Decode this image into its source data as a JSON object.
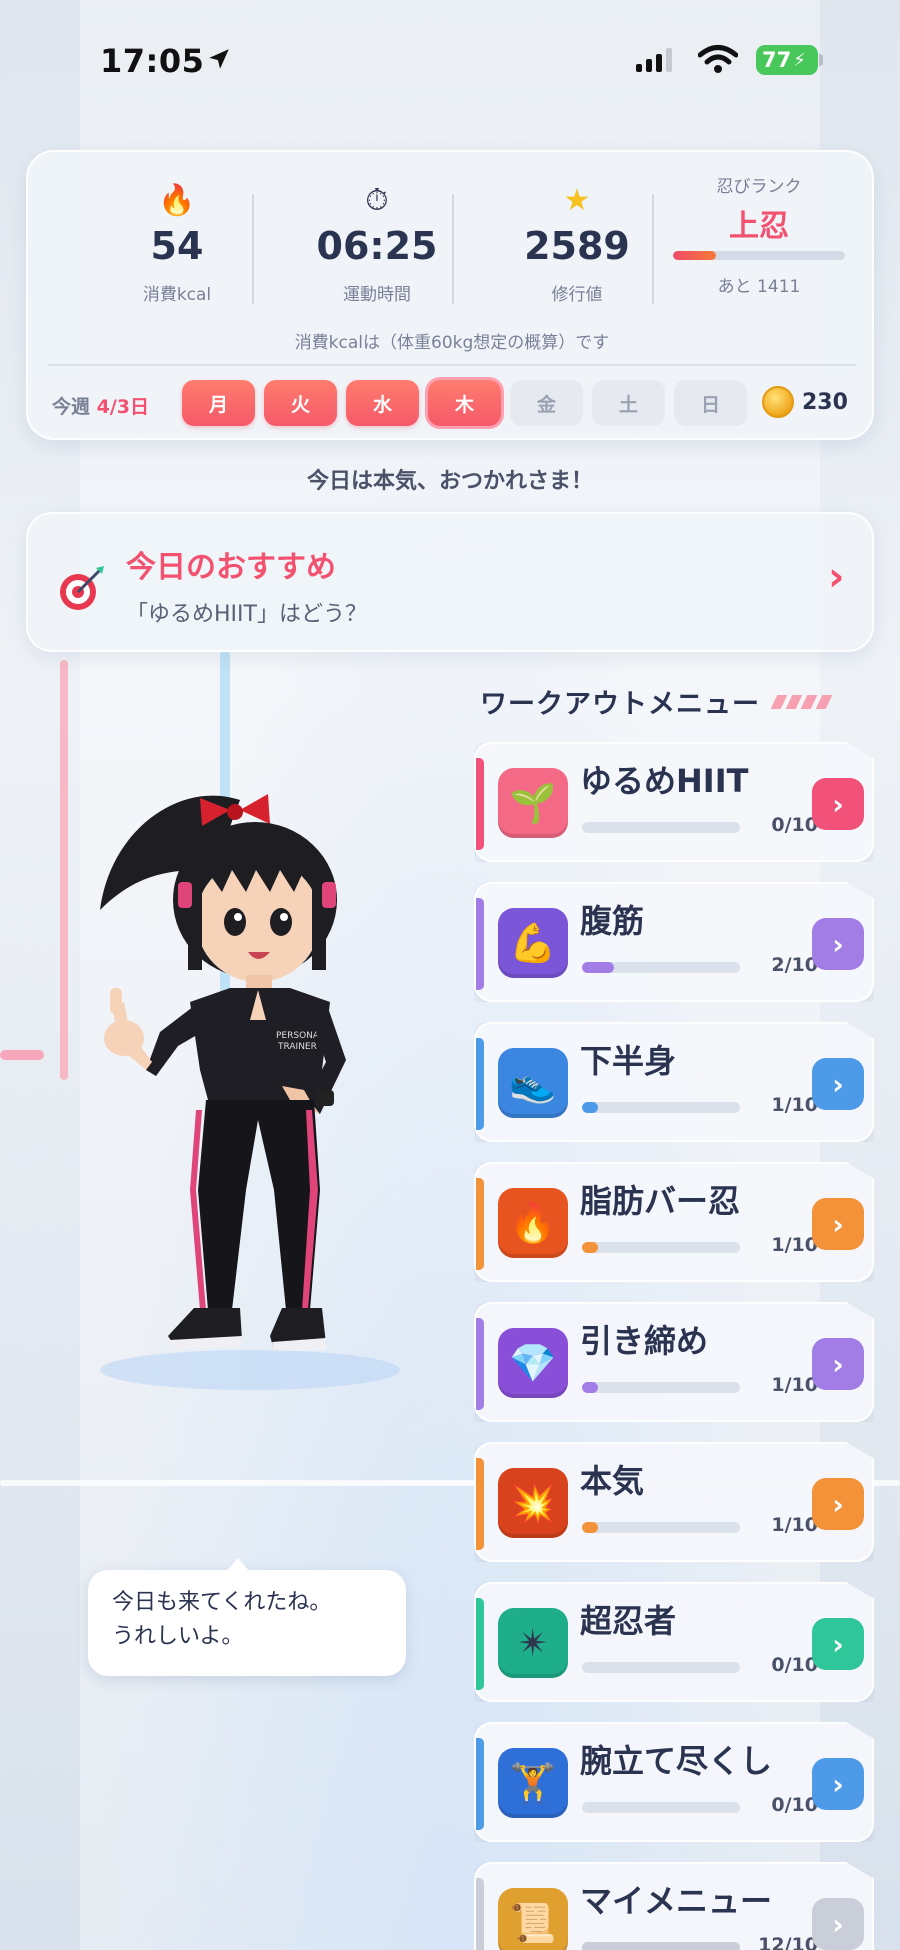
{
  "status": {
    "time": "17:05",
    "battery": "77"
  },
  "stats": {
    "calories": {
      "value": "54",
      "label": "消費kcal"
    },
    "duration": {
      "value": "06:25",
      "label": "運動時間"
    },
    "points": {
      "value": "2589",
      "label": "修行値"
    },
    "rank": {
      "title": "忍びランク",
      "name": "上忍",
      "remaining": "あと 1411",
      "progress": 0.25
    },
    "note": "消費kcalは（体重60kg想定の概算）です"
  },
  "week": {
    "label": "今週",
    "count": "4/3日",
    "days": [
      {
        "label": "月",
        "done": true
      },
      {
        "label": "火",
        "done": true
      },
      {
        "label": "水",
        "done": true
      },
      {
        "label": "木",
        "done": true,
        "today": true
      },
      {
        "label": "金",
        "done": false
      },
      {
        "label": "土",
        "done": false
      },
      {
        "label": "日",
        "done": false
      }
    ],
    "coins": "230"
  },
  "greeting": "今日は本気、おつかれさま！",
  "recommendation": {
    "title": "今日のおすすめ",
    "subtitle": "「ゆるめHIIT」はどう？",
    "chevron": "›"
  },
  "workout_menu": {
    "title": "ワークアウトメニュー",
    "items": [
      {
        "name": "ゆるめHIIT",
        "progress": "0/10",
        "ratio": 0.0,
        "color": "#f2517a",
        "icon": "sprout-icon",
        "glyph": "🌱",
        "icon_bg": "#f46a86"
      },
      {
        "name": "腹筋",
        "progress": "2/10",
        "ratio": 0.2,
        "color": "#a27de6",
        "icon": "flexed-biceps-icon",
        "glyph": "💪",
        "icon_bg": "#7b56d9"
      },
      {
        "name": "下半身",
        "progress": "1/10",
        "ratio": 0.1,
        "color": "#4d9be8",
        "icon": "running-shoe-icon",
        "glyph": "👟",
        "icon_bg": "#3b86e0"
      },
      {
        "name": "脂肪バー忍",
        "progress": "1/10",
        "ratio": 0.1,
        "color": "#f4923a",
        "icon": "fire-icon",
        "glyph": "🔥",
        "icon_bg": "#e8541f"
      },
      {
        "name": "引き締め",
        "progress": "1/10",
        "ratio": 0.1,
        "color": "#a27de6",
        "icon": "diamond-icon",
        "glyph": "💎",
        "icon_bg": "#8a4fd8"
      },
      {
        "name": "本気",
        "progress": "1/10",
        "ratio": 0.1,
        "color": "#f4923a",
        "icon": "explosion-icon",
        "glyph": "💥",
        "icon_bg": "#d8421c"
      },
      {
        "name": "超忍者",
        "progress": "0/10",
        "ratio": 0.0,
        "color": "#2fc79a",
        "icon": "shuriken-icon",
        "glyph": "✴",
        "icon_bg": "#1fae8a"
      },
      {
        "name": "腕立て尽くし",
        "progress": "0/10",
        "ratio": 0.0,
        "color": "#4d9be8",
        "icon": "dumbbell-icon",
        "glyph": "🏋",
        "icon_bg": "#2f6fd8"
      },
      {
        "name": "マイメニュー",
        "progress": "12/10",
        "ratio": 1.0,
        "color": "#c9ced8",
        "icon": "scroll-icon",
        "glyph": "📜",
        "icon_bg": "#e0a030"
      }
    ]
  },
  "trainer": {
    "speech_line1": "今日も来てくれたね。",
    "speech_line2": "うれしいよ。",
    "shirt_text_line1": "PERSONAL",
    "shirt_text_line2": "TRAINER"
  }
}
